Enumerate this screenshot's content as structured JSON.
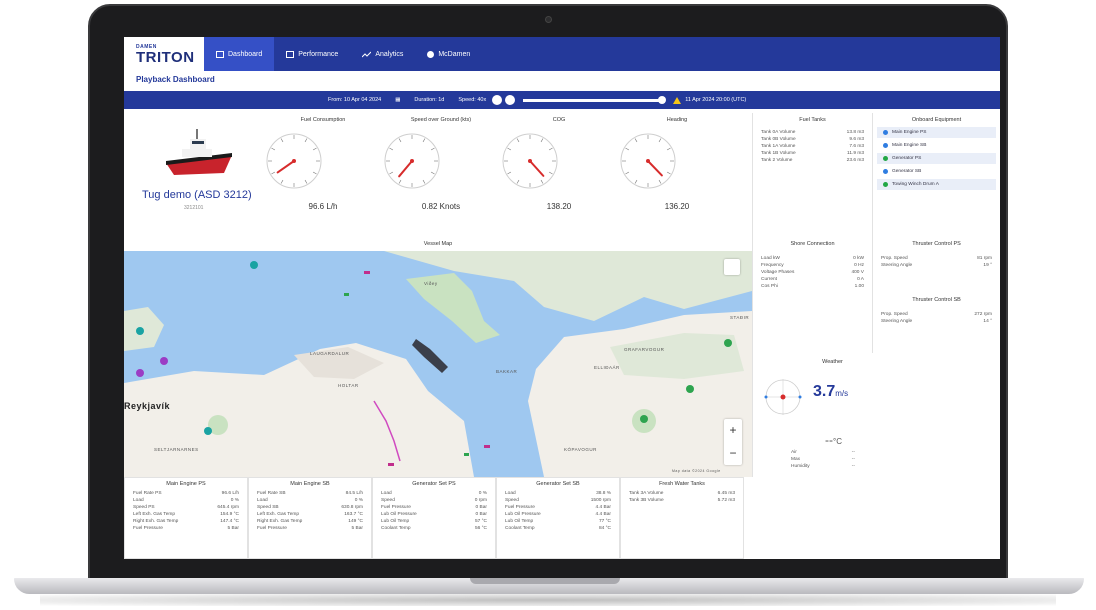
{
  "nav": {
    "brand_sub": "DAMEN",
    "brand": "TRITON",
    "items": [
      {
        "label": "Dashboard",
        "active": true
      },
      {
        "label": "Performance",
        "active": false
      },
      {
        "label": "Analytics",
        "active": false
      },
      {
        "label": "McDamen",
        "active": false
      }
    ]
  },
  "page_title": "Playback Dashboard",
  "playback": {
    "from_label": "From: 10 Apr 04 2024",
    "duration_label": "Duration: 1d",
    "speed_label": "Speed: 40x",
    "timestamp": "11 Apr 2024 20:00 (UTC)"
  },
  "vessel": {
    "name": "Tug demo (ASD 3212)",
    "id": "3212101"
  },
  "gauges": [
    {
      "title": "Fuel Consumption",
      "value": "96.6 L/h",
      "needle_deg": 235
    },
    {
      "title": "Speed over Ground (kts)",
      "value": "0.82 Knots",
      "needle_deg": 220
    },
    {
      "title": "COG",
      "value": "138.20",
      "needle_deg": 138
    },
    {
      "title": "Heading",
      "value": "136.20",
      "needle_deg": 136
    }
  ],
  "fuel_tanks": {
    "title": "Fuel Tanks",
    "rows": [
      {
        "k": "Tank 0A Volume",
        "v": "13.8 m3"
      },
      {
        "k": "Tank 0B Volume",
        "v": "9.6 m3"
      },
      {
        "k": "Tank 1A Volume",
        "v": "7.6 m3"
      },
      {
        "k": "Tank 1B Volume",
        "v": "11.9 m3"
      },
      {
        "k": "Tank 2 Volume",
        "v": "23.6 m3"
      }
    ]
  },
  "onboard_equipment": {
    "title": "Onboard Equipment",
    "items": [
      {
        "label": "Main Engine PS",
        "color": "#2f7de1"
      },
      {
        "label": "Main Engine SB",
        "color": "#2f7de1"
      },
      {
        "label": "Generator PS",
        "color": "#22a745"
      },
      {
        "label": "Generator SB",
        "color": "#2f7de1"
      },
      {
        "label": "Towing Winch Drum A",
        "color": "#22a745"
      }
    ]
  },
  "shore_connection": {
    "title": "Shore Connection",
    "rows": [
      {
        "k": "Load kW",
        "v": "0 kW"
      },
      {
        "k": "Frequency",
        "v": "0 Hz"
      },
      {
        "k": "Voltage Phases",
        "v": "400 V"
      },
      {
        "k": "Current",
        "v": "0 A"
      },
      {
        "k": "Cos Phi",
        "v": "1.00"
      }
    ]
  },
  "thruster_ps": {
    "title": "Thruster Control PS",
    "rows": [
      {
        "k": "Prop. Speed",
        "v": "81 rpm"
      },
      {
        "k": "Steering Angle",
        "v": "19 °"
      }
    ]
  },
  "thruster_sb": {
    "title": "Thruster Control SB",
    "rows": [
      {
        "k": "Prop. Speed",
        "v": "272 rpm"
      },
      {
        "k": "Steering Angle",
        "v": "14 °"
      }
    ]
  },
  "weather": {
    "title": "Weather",
    "wind_speed": "3.7",
    "wind_unit": "m/s",
    "temp": "--",
    "temp_unit": "°C",
    "rows": [
      {
        "k": "Air",
        "v": "--"
      },
      {
        "k": "Max",
        "v": "--"
      },
      {
        "k": "Humidity",
        "v": "--"
      }
    ]
  },
  "map": {
    "title": "Vessel Map",
    "city_label": "Reykjavík",
    "labels": [
      "LAUGARDALUR",
      "HOLTAR",
      "ELLIÐAÁR",
      "GRAFARVOGUR",
      "SELTJARNARNES",
      "KÓPAVOGUR",
      "BAKKAR",
      "STAÐIR",
      "Viðey"
    ],
    "zoom_in": "+",
    "zoom_out": "−",
    "attribution": "Map data ©2024 Google"
  },
  "bottom_cards": [
    {
      "title": "Main Engine PS",
      "rows": [
        {
          "k": "Fuel Rate PS",
          "v": "96.6 L/h"
        },
        {
          "k": "Load",
          "v": "0 %"
        },
        {
          "k": "Speed PS",
          "v": "645.4 rpm"
        },
        {
          "k": "Left Exh. Gas Temp",
          "v": "154.9 °C"
        },
        {
          "k": "Right Exh. Gas Temp",
          "v": "147.4 °C"
        },
        {
          "k": "Fuel Pressure",
          "v": "5 Bar"
        }
      ]
    },
    {
      "title": "Main Engine SB",
      "rows": [
        {
          "k": "Fuel Rate SB",
          "v": "84.5 L/h"
        },
        {
          "k": "Load",
          "v": "0 %"
        },
        {
          "k": "Speed SB",
          "v": "630.8 rpm"
        },
        {
          "k": "Left Exh. Gas Temp",
          "v": "163.7 °C"
        },
        {
          "k": "Right Exh. Gas Temp",
          "v": "149 °C"
        },
        {
          "k": "Fuel Pressure",
          "v": "5 Bar"
        }
      ]
    },
    {
      "title": "Generator Set PS",
      "rows": [
        {
          "k": "Load",
          "v": "0 %"
        },
        {
          "k": "Speed",
          "v": "0 rpm"
        },
        {
          "k": "Fuel Pressure",
          "v": "0 Bar"
        },
        {
          "k": "Lub Oil Pressure",
          "v": "0 Bar"
        },
        {
          "k": "Lub Oil Temp",
          "v": "57 °C"
        },
        {
          "k": "Coolant Temp",
          "v": "56 °C"
        }
      ]
    },
    {
      "title": "Generator Set SB",
      "rows": [
        {
          "k": "Load",
          "v": "38.8 %"
        },
        {
          "k": "Speed",
          "v": "1500 rpm"
        },
        {
          "k": "Fuel Pressure",
          "v": "4.4 Bar"
        },
        {
          "k": "Lub Oil Pressure",
          "v": "4.4 Bar"
        },
        {
          "k": "Lub Oil Temp",
          "v": "77 °C"
        },
        {
          "k": "Coolant Temp",
          "v": "84 °C"
        }
      ]
    },
    {
      "title": "Fresh Water Tanks",
      "rows": [
        {
          "k": "Tank 3A Volume",
          "v": "6.45 m3"
        },
        {
          "k": "Tank 3B Volume",
          "v": "5.72 m3"
        }
      ]
    }
  ]
}
